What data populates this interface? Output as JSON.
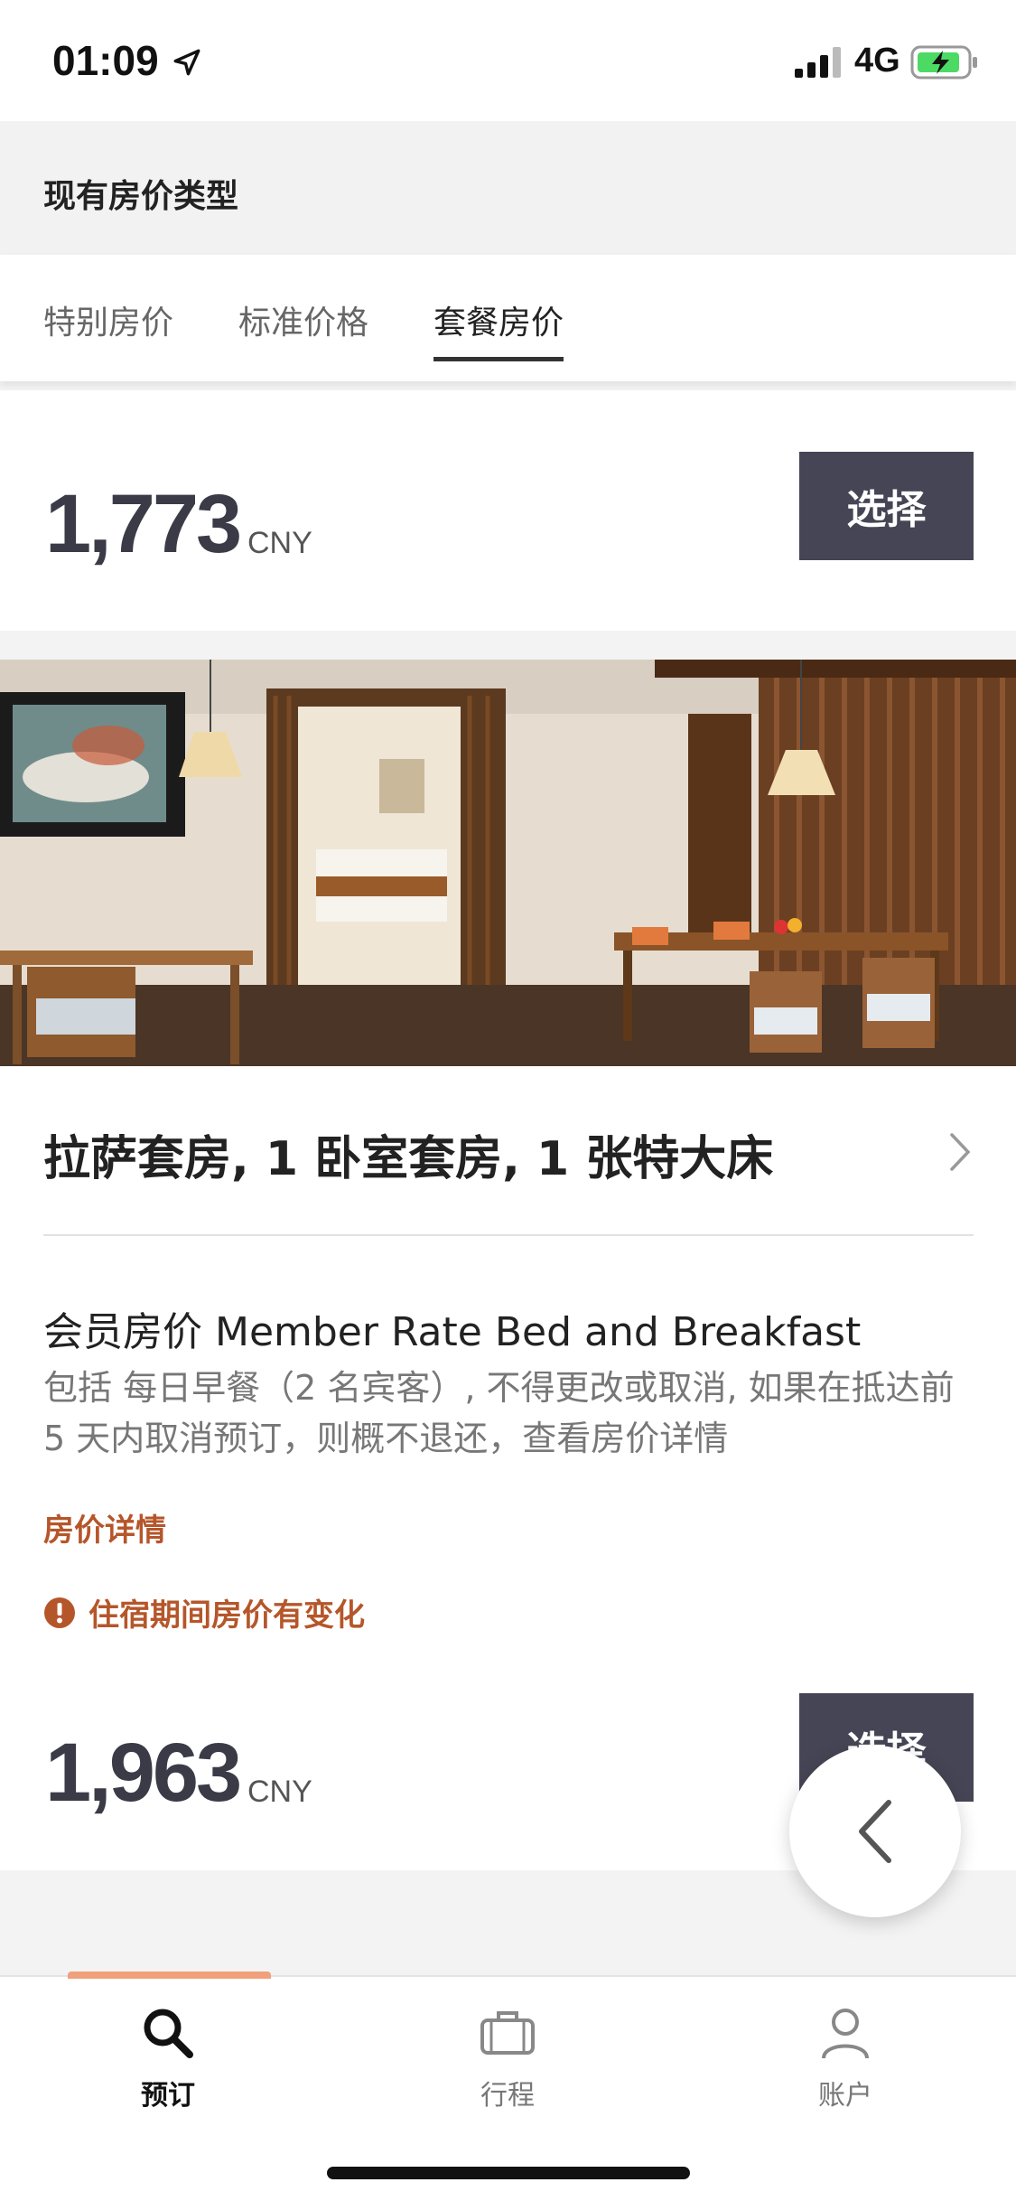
{
  "status_bar": {
    "time": "01:09",
    "network": "4G"
  },
  "section": {
    "title": "现有房价类型"
  },
  "tabs": [
    {
      "label": "特别房价",
      "active": false
    },
    {
      "label": "标准价格",
      "active": false
    },
    {
      "label": "套餐房价",
      "active": true
    }
  ],
  "offer_top": {
    "price": "1,773",
    "currency": "CNY",
    "select_label": "选择"
  },
  "room": {
    "name": "拉萨套房, 1 卧室套房, 1  张特大床",
    "rate_title": "会员房价 Member Rate Bed and Breakfast",
    "rate_description": "包括  每日早餐（2 名宾客）, 不得更改或取消, 如果在抵达前 5 天内取消预订，则概不退还，查看房价详情",
    "details_link": "房价详情",
    "notice": "住宿期间房价有变化",
    "price": "1,963",
    "currency": "CNY",
    "select_label": "选择"
  },
  "bottom_nav": {
    "items": [
      {
        "label": "预订",
        "icon": "search-icon",
        "active": true
      },
      {
        "label": "行程",
        "icon": "briefcase-icon",
        "active": false
      },
      {
        "label": "账户",
        "icon": "person-icon",
        "active": false
      }
    ]
  },
  "colors": {
    "accent": "#b5562a",
    "button": "#464555",
    "nav_active_bar": "#f0a07a"
  }
}
